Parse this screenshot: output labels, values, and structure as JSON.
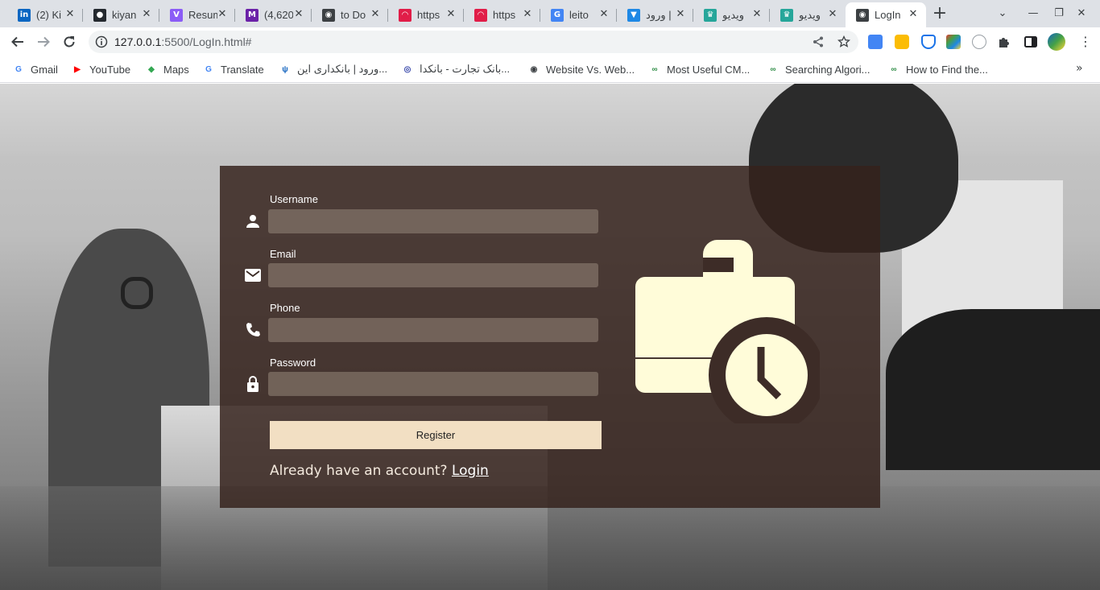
{
  "tabs": [
    {
      "title": "(2) Ki",
      "icon": "linkedin-icon",
      "color": "#0a66c2",
      "glyph": "in"
    },
    {
      "title": "kiyan",
      "icon": "github-icon",
      "color": "#24292f",
      "glyph": "●"
    },
    {
      "title": "Resum",
      "icon": "vite-icon",
      "color": "#8b5cf6",
      "glyph": "V"
    },
    {
      "title": "(4,620",
      "icon": "mail-icon",
      "color": "#6b21a8",
      "glyph": "M"
    },
    {
      "title": "to Do",
      "icon": "globe-icon",
      "color": "#3c4043",
      "glyph": "◉"
    },
    {
      "title": "https",
      "icon": "app-icon",
      "color": "#e11d48",
      "glyph": "◠"
    },
    {
      "title": "https",
      "icon": "app-icon",
      "color": "#e11d48",
      "glyph": "◠"
    },
    {
      "title": "leito",
      "icon": "google-icon",
      "color": "#4285f4",
      "glyph": "G"
    },
    {
      "title": "ورود |",
      "icon": "bank-icon",
      "color": "#1e88e5",
      "glyph": "▼"
    },
    {
      "title": "ویدیو",
      "icon": "shirt-icon",
      "color": "#26a69a",
      "glyph": "♛"
    },
    {
      "title": "ویدیو",
      "icon": "shirt-icon",
      "color": "#26a69a",
      "glyph": "♛"
    },
    {
      "title": "LogIn",
      "icon": "globe-icon",
      "color": "#3c4043",
      "glyph": "◉"
    }
  ],
  "address": {
    "host": "127.0.0.1",
    "rest": ":5500/LogIn.html#"
  },
  "bookmarks": [
    {
      "label": "Gmail",
      "icon": "google-icon",
      "color": "#4285f4",
      "glyph": "G"
    },
    {
      "label": "YouTube",
      "icon": "youtube-icon",
      "color": "#ff0000",
      "glyph": "▶"
    },
    {
      "label": "Maps",
      "icon": "maps-icon",
      "color": "#34a853",
      "glyph": "◆"
    },
    {
      "label": "Translate",
      "icon": "translate-icon",
      "color": "#4285f4",
      "glyph": "G"
    },
    {
      "label": "ورود | بانکداری این...",
      "icon": "bank-icon",
      "color": "#1565c0",
      "glyph": "ψ"
    },
    {
      "label": "بانک تجارت - بانکدا...",
      "icon": "bank-icon",
      "color": "#3949ab",
      "glyph": "◎"
    },
    {
      "label": "Website Vs. Web...",
      "icon": "globe-icon",
      "color": "#3c4043",
      "glyph": "◉"
    },
    {
      "label": "Most Useful CM...",
      "icon": "gfg-icon",
      "color": "#2f8d46",
      "glyph": "∞"
    },
    {
      "label": "Searching Algori...",
      "icon": "gfg-icon",
      "color": "#2f8d46",
      "glyph": "∞"
    },
    {
      "label": "How to Find the...",
      "icon": "gfg-icon",
      "color": "#2f8d46",
      "glyph": "∞"
    }
  ],
  "form": {
    "username_label": "Username",
    "email_label": "Email",
    "phone_label": "Phone",
    "password_label": "Password",
    "register_label": "Register",
    "already_text": "Already have an account?",
    "login_link": "Login"
  }
}
